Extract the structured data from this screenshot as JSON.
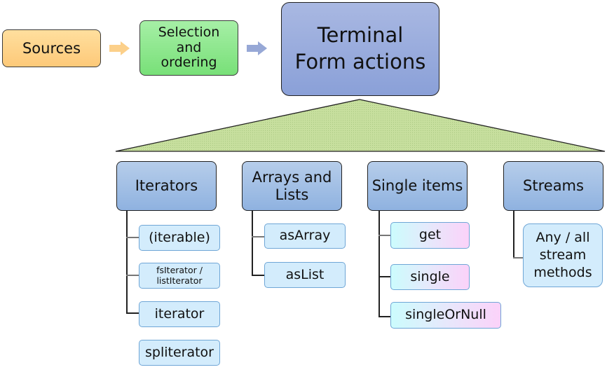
{
  "pipeline": {
    "sources": "Sources",
    "selection": "Selection and ordering",
    "terminal": "Terminal Form actions"
  },
  "colors": {
    "sources_fill": "#fdd58a",
    "selection_fill": "#8ee88e",
    "terminal_fill": "#98abdc",
    "category_fill": "#a3c0e6",
    "leaf_fill": "#d3ecfc",
    "triangle_fill": "#c4dd9c"
  },
  "categories": [
    {
      "label": "Iterators",
      "items": [
        "(iterable)",
        "fsIterator / listIterator",
        "iterator",
        "spliterator"
      ]
    },
    {
      "label": "Arrays and Lists",
      "items": [
        "asArray",
        "asList"
      ]
    },
    {
      "label": "Single items",
      "items": [
        "get",
        "single",
        "singleOrNull"
      ]
    },
    {
      "label": "Streams",
      "items": [
        "Any / all stream methods"
      ]
    }
  ]
}
